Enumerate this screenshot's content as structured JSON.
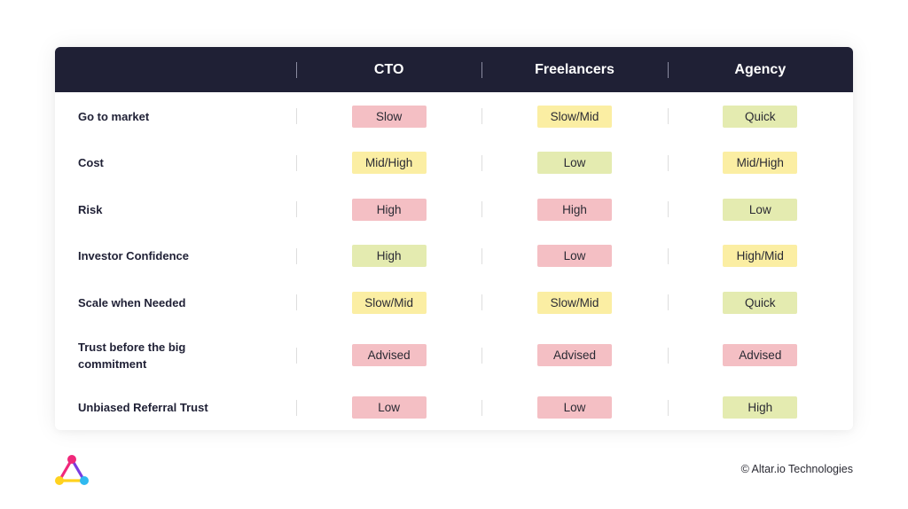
{
  "table": {
    "columns": [
      "CTO",
      "Freelancers",
      "Agency"
    ],
    "rows": [
      {
        "label": "Go to market",
        "values": [
          {
            "text": "Slow",
            "tone": "red"
          },
          {
            "text": "Slow/Mid",
            "tone": "yellow"
          },
          {
            "text": "Quick",
            "tone": "green"
          }
        ]
      },
      {
        "label": "Cost",
        "values": [
          {
            "text": "Mid/High",
            "tone": "yellow"
          },
          {
            "text": "Low",
            "tone": "green"
          },
          {
            "text": "Mid/High",
            "tone": "yellow"
          }
        ]
      },
      {
        "label": "Risk",
        "values": [
          {
            "text": "High",
            "tone": "red"
          },
          {
            "text": "High",
            "tone": "red"
          },
          {
            "text": "Low",
            "tone": "green"
          }
        ]
      },
      {
        "label": "Investor Confidence",
        "values": [
          {
            "text": "High",
            "tone": "green"
          },
          {
            "text": "Low",
            "tone": "red"
          },
          {
            "text": "High/Mid",
            "tone": "yellow"
          }
        ]
      },
      {
        "label": "Scale when Needed",
        "values": [
          {
            "text": "Slow/Mid",
            "tone": "yellow"
          },
          {
            "text": "Slow/Mid",
            "tone": "yellow"
          },
          {
            "text": "Quick",
            "tone": "green"
          }
        ]
      },
      {
        "label": "Trust before the big commitment",
        "values": [
          {
            "text": "Advised",
            "tone": "red"
          },
          {
            "text": "Advised",
            "tone": "red"
          },
          {
            "text": "Advised",
            "tone": "red"
          }
        ]
      },
      {
        "label": "Unbiased Referral Trust",
        "values": [
          {
            "text": "Low",
            "tone": "red"
          },
          {
            "text": "Low",
            "tone": "red"
          },
          {
            "text": "High",
            "tone": "green"
          }
        ]
      }
    ]
  },
  "tones": {
    "red": "#f4bfc4",
    "yellow": "#fbeea3",
    "green": "#e4ebb0"
  },
  "header_color": "#1f2035",
  "logo": {
    "icon": "altar-triangle-logo-icon",
    "colors": [
      "#f0287a",
      "#ffd21f",
      "#2fb9f0",
      "#7a3ce0"
    ]
  },
  "footer": {
    "copyright": "© Altar.io Technologies"
  }
}
